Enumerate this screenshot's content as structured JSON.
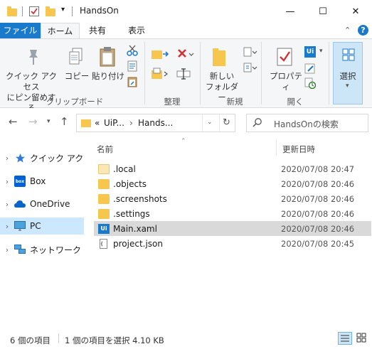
{
  "window": {
    "title": "HandsOn",
    "minimize": "—",
    "maximize": "☐",
    "close": "✕"
  },
  "ribbon_tabs": {
    "file": "ファイル",
    "home": "ホーム",
    "share": "共有",
    "view": "表示"
  },
  "ribbon": {
    "pin_quick_access": [
      "クイック アクセス",
      "にピン留めする"
    ],
    "copy": "コピー",
    "paste": "貼り付け",
    "group_clipboard": "クリップボード",
    "group_organize": "整理",
    "new_folder": [
      "新しい",
      "フォルダー"
    ],
    "group_new": "新規",
    "properties": "プロパティ",
    "group_open": "開く",
    "select": "選択"
  },
  "address": {
    "overflow": "«",
    "crumbs": [
      "UiP...",
      "Hands..."
    ],
    "search_placeholder": "HandsOnの検索"
  },
  "navpane": {
    "items": [
      {
        "label": "クイック アクセス",
        "icon": "star-icon"
      },
      {
        "label": "Box",
        "icon": "box-icon"
      },
      {
        "label": "OneDrive",
        "icon": "cloud-icon"
      },
      {
        "label": "PC",
        "icon": "monitor-icon"
      },
      {
        "label": "ネットワーク",
        "icon": "network-icon"
      }
    ]
  },
  "filelist": {
    "col_name": "名前",
    "col_date": "更新日時",
    "files": [
      {
        "name": ".local",
        "date": "2020/07/08 20:47",
        "type": "folder-light"
      },
      {
        "name": ".objects",
        "date": "2020/07/08 20:46",
        "type": "folder"
      },
      {
        "name": ".screenshots",
        "date": "2020/07/08 20:46",
        "type": "folder"
      },
      {
        "name": ".settings",
        "date": "2020/07/08 20:46",
        "type": "folder"
      },
      {
        "name": "Main.xaml",
        "date": "2020/07/08 20:46",
        "type": "uipath"
      },
      {
        "name": "project.json",
        "date": "2020/07/08 20:45",
        "type": "json"
      }
    ]
  },
  "status": {
    "item_count": "6 個の項目",
    "selection": "1 個の項目を選択  4.10 KB"
  },
  "colors": {
    "accent": "#1979ca",
    "folder": "#f6c64d",
    "selected_nav": "#cce8ff"
  }
}
